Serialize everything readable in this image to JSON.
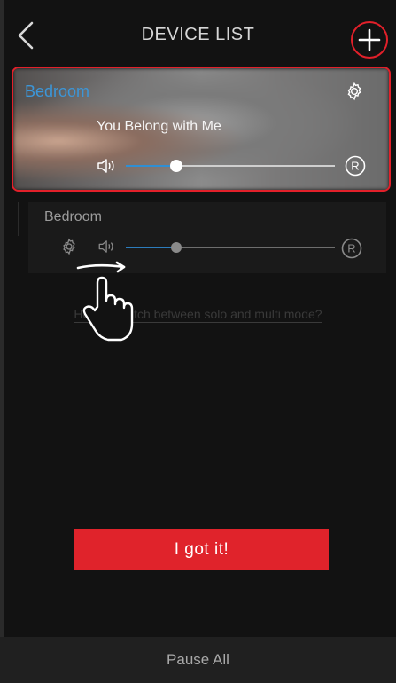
{
  "header": {
    "title": "DEVICE LIST",
    "back_icon": "chevron-left-icon",
    "add_icon": "plus-icon"
  },
  "devices": [
    {
      "room": "Bedroom",
      "song": "You Belong with Me",
      "volume": 0.24,
      "icons": [
        "gear-icon",
        "speaker-icon",
        "r-badge-icon"
      ]
    },
    {
      "room": "Bedroom",
      "volume": 0.24,
      "icons": [
        "gear-icon",
        "speaker-icon",
        "r-badge-icon"
      ]
    }
  ],
  "hint": "How to switch between solo and multi mode?",
  "got_it_label": "I got it!",
  "footer": {
    "pause_all_label": "Pause All"
  },
  "colors": {
    "accent_red": "#e2202a",
    "accent_blue": "#2f8fd4",
    "background": "#121212"
  }
}
